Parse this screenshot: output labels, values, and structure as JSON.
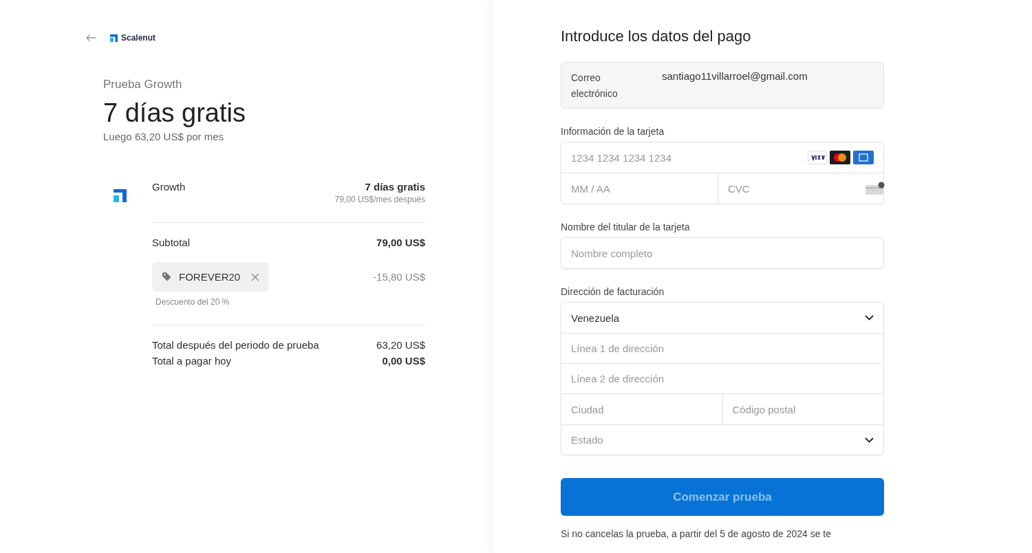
{
  "header": {
    "brand": "Scalenut"
  },
  "plan": {
    "eyebrow": "Prueba Growth",
    "headline": "7 días gratis",
    "subline": "Luego 63,20 US$ por mes"
  },
  "item": {
    "name": "Growth",
    "price": "7 días gratis",
    "note": "79,00 US$/mes después"
  },
  "subtotal": {
    "label": "Subtotal",
    "amount": "79,00 US$"
  },
  "coupon": {
    "code": "FOREVER20",
    "amount": "-15,80 US$",
    "note": "Descuento del 20 %"
  },
  "totals": [
    {
      "label": "Total después del periodo de prueba",
      "amount": "63,20 US$",
      "emphasis": false
    },
    {
      "label": "Total a pagar hoy",
      "amount": "0,00 US$",
      "emphasis": true
    }
  ],
  "payment": {
    "title": "Introduce los datos del pago",
    "email": {
      "label": "Correo electrónico",
      "value": "santiago11villarroel@gmail.com"
    },
    "card": {
      "label": "Información de la tarjeta",
      "number_placeholder": "1234 1234 1234 1234",
      "expiry_placeholder": "MM / AA",
      "cvc_placeholder": "CVC"
    },
    "holder": {
      "label": "Nombre del titular de la tarjeta",
      "placeholder": "Nombre completo"
    },
    "billing": {
      "label": "Dirección de facturación",
      "country": "Venezuela",
      "line1_placeholder": "Línea 1 de dirección",
      "line2_placeholder": "Línea 2 de dirección",
      "city_placeholder": "Ciudad",
      "postal_placeholder": "Código postal",
      "state_placeholder": "Estado"
    },
    "submit": {
      "label": "Comenzar prueba",
      "disabled": true
    },
    "footnote": "Si no cancelas la prueba, a partir del 5 de agosto de 2024 se te"
  }
}
